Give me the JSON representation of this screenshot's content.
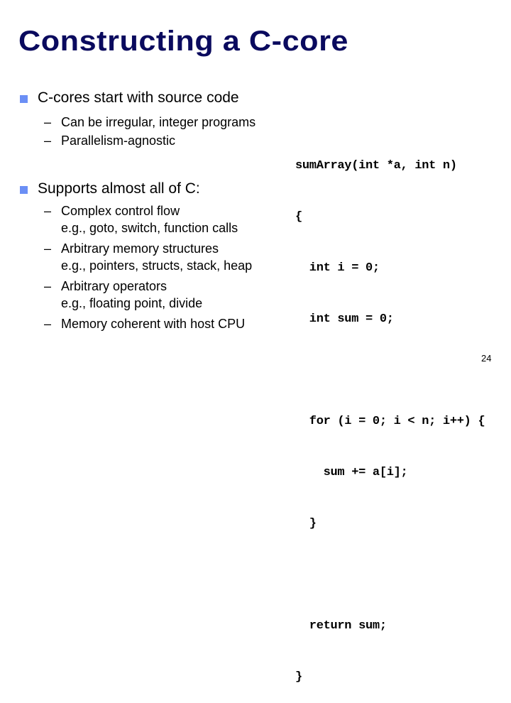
{
  "slide": {
    "title": "Constructing a C-core",
    "bullets": [
      {
        "text": "C-cores start with source code",
        "sub": [
          {
            "text": "Can be irregular, integer programs",
            "cont": ""
          },
          {
            "text": "Parallelism-agnostic",
            "cont": ""
          }
        ]
      },
      {
        "text": "Supports almost all of C:",
        "sub": [
          {
            "text": "Complex control flow",
            "cont": "e.g., goto, switch, function calls"
          },
          {
            "text": "Arbitrary memory structures",
            "cont": "e.g., pointers, structs, stack, heap"
          },
          {
            "text": "Arbitrary operators",
            "cont": "e.g., floating point, divide"
          },
          {
            "text": "Memory coherent with host CPU",
            "cont": ""
          }
        ]
      }
    ],
    "dash": "–",
    "code_lines": [
      "sumArray(int *a, int n)",
      "{",
      "  int i = 0;",
      "  int sum = 0;",
      "",
      "  for (i = 0; i < n; i++) {",
      "    sum += a[i];",
      "  }",
      "",
      "  return sum;",
      "}"
    ],
    "page_number": "24",
    "colors": {
      "title": "#0a0a5e",
      "bullet": "#6b8ff5"
    }
  }
}
